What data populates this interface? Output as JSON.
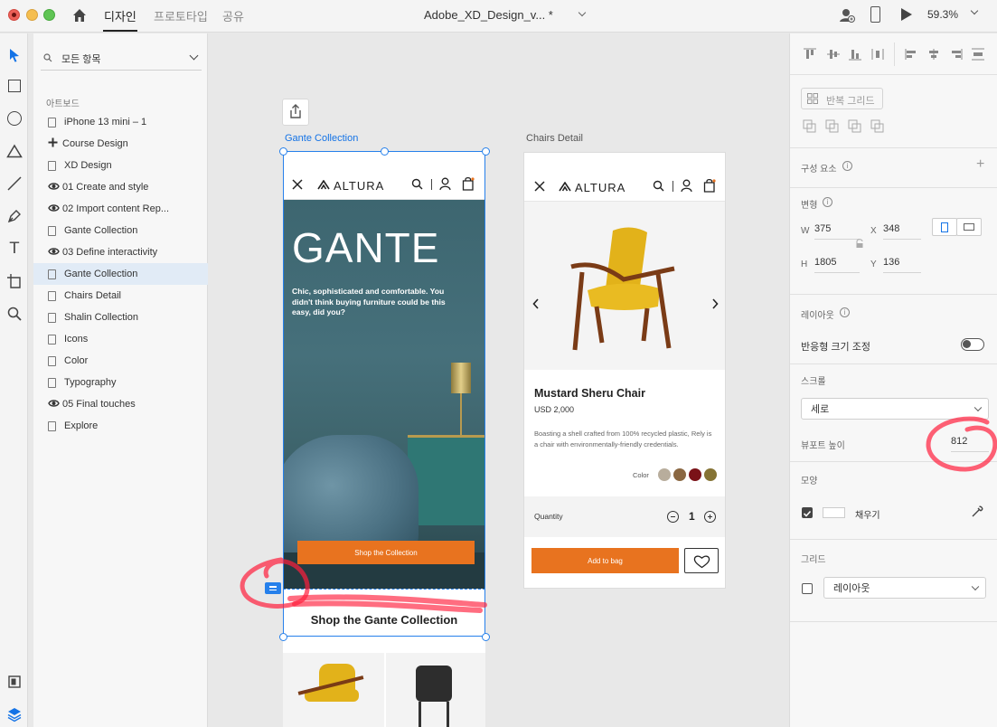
{
  "titlebar": {
    "tabs": [
      "디자인",
      "프로토타입",
      "공유"
    ],
    "doc_title": "Adobe_XD_Design_v... *",
    "zoom": "59.3%"
  },
  "layers": {
    "filter_label": "모든 항목",
    "section_label": "아트보드",
    "items": [
      {
        "label": "iPhone 13 mini – 1",
        "icon": "doc"
      },
      {
        "label": "Course Design",
        "icon": "plus"
      },
      {
        "label": "XD Design",
        "icon": "doc"
      },
      {
        "label": "01 Create and style",
        "icon": "eye"
      },
      {
        "label": "02 Import content Rep...",
        "icon": "eye"
      },
      {
        "label": "Gante Collection",
        "icon": "doc"
      },
      {
        "label": "03 Define interactivity",
        "icon": "eye"
      },
      {
        "label": "Gante Collection",
        "icon": "doc",
        "selected": true
      },
      {
        "label": "Chairs Detail",
        "icon": "doc"
      },
      {
        "label": "Shalin Collection",
        "icon": "doc"
      },
      {
        "label": "Icons",
        "icon": "doc"
      },
      {
        "label": "Color",
        "icon": "doc"
      },
      {
        "label": "Typography",
        "icon": "doc"
      },
      {
        "label": "05 Final touches",
        "icon": "eye"
      },
      {
        "label": "Explore",
        "icon": "doc"
      }
    ]
  },
  "canvas": {
    "artboard1": {
      "label": "Gante Collection",
      "brand": "ALTURA",
      "hero_title": "GANTE",
      "hero_text": "Chic, sophisticated and comfortable. You didn't think buying furniture could be this easy, did you?",
      "cta": "Shop the Collection",
      "section_title": "Shop the Gante Collection"
    },
    "artboard2": {
      "label": "Chairs Detail",
      "brand": "ALTURA",
      "product_name": "Mustard Sheru Chair",
      "price": "USD 2,000",
      "description": "Boasting a shell crafted from 100% recycled plastic, Rely is a chair with environmentally-friendly credentials.",
      "color_label": "Color",
      "swatches": [
        "#b8ad9c",
        "#8a6742",
        "#7a1218",
        "#857334"
      ],
      "quantity_label": "Quantity",
      "quantity": "1",
      "add_to_bag": "Add to bag"
    }
  },
  "props": {
    "components_label": "구성 요소",
    "repeat_grid": "반복 그리드",
    "transform_label": "변형",
    "w_label": "W",
    "w": "375",
    "x_label": "X",
    "x": "348",
    "h_label": "H",
    "h": "1805",
    "y_label": "Y",
    "y": "136",
    "layout_label": "레이아웃",
    "responsive_resize": "반응형 크기 조정",
    "scroll_label": "스크롤",
    "scroll_value": "세로",
    "viewport_label": "뷰포트 높이",
    "viewport_height": "812",
    "appearance_label": "모양",
    "fill_label": "채우기",
    "grid_label": "그리드",
    "grid_value": "레이아웃"
  }
}
